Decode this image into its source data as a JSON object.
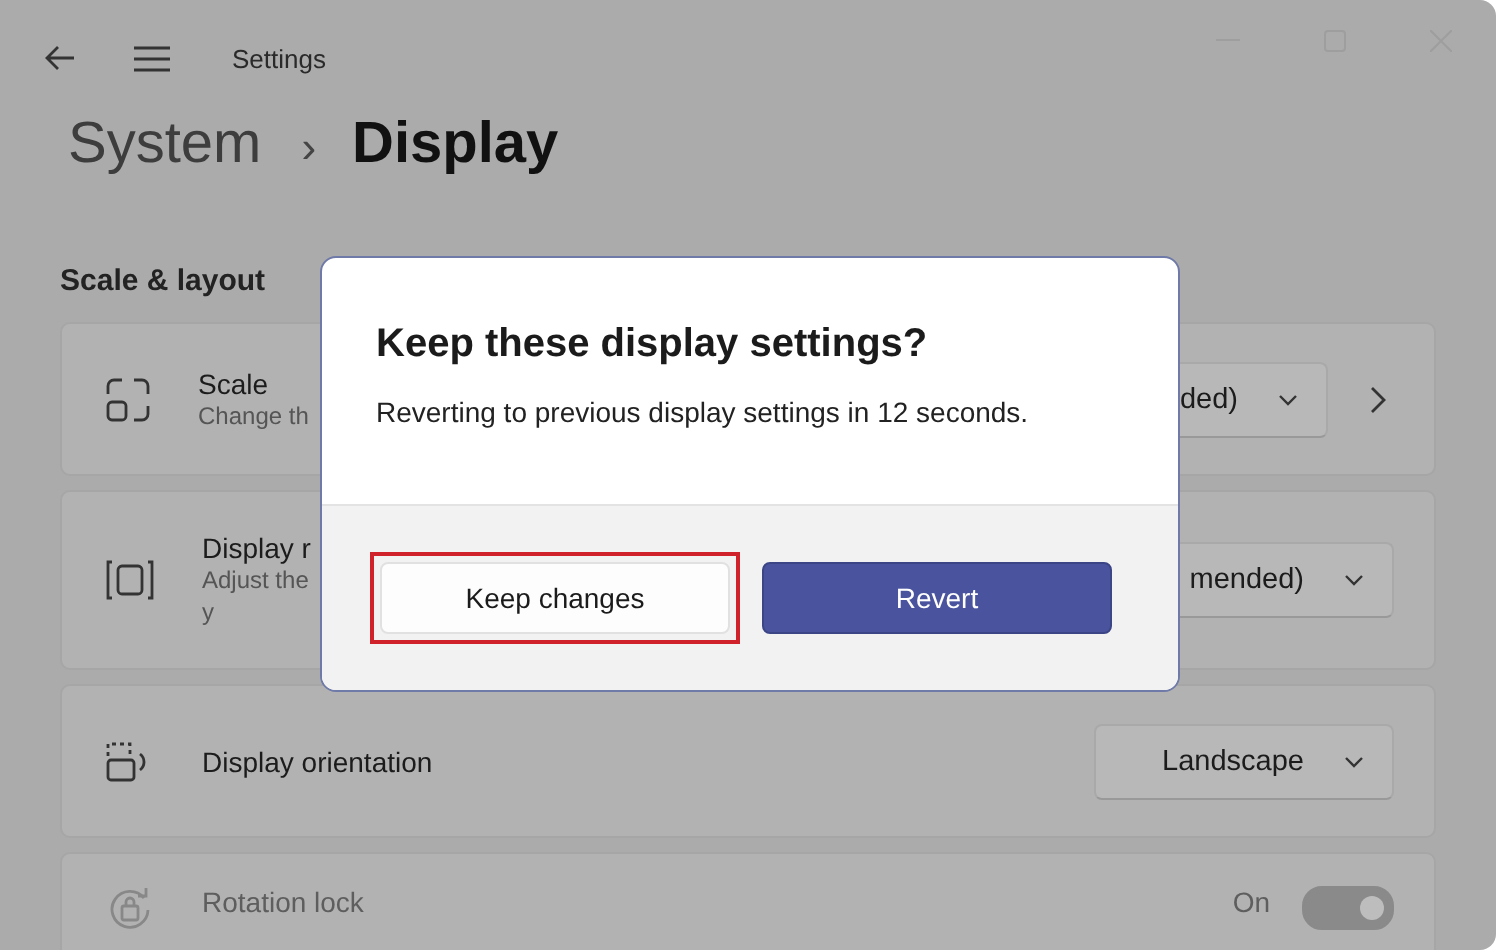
{
  "window": {
    "title": "Settings"
  },
  "breadcrumb": {
    "parent": "System",
    "separator": "›",
    "current": "Display"
  },
  "section": "Scale & layout",
  "rows": [
    {
      "kind": "dropdown",
      "title": "Scale",
      "subtitle": [
        "Change th"
      ],
      "value": "ded)",
      "link": true
    },
    {
      "kind": "dropdown",
      "title": "Display r",
      "subtitle": [
        "Adjust the",
        "y"
      ],
      "value": "mended)",
      "link": false
    },
    {
      "kind": "dropdown",
      "title": "Display orientation",
      "value": "Landscape",
      "link": false
    },
    {
      "kind": "toggle",
      "title": "Rotation lock",
      "disabled": true,
      "state": "On",
      "on": true
    }
  ],
  "dialog": {
    "title": "Keep these display settings?",
    "message": "Reverting to previous display settings in 12 seconds.",
    "buttons": [
      {
        "label": "Keep changes",
        "primary": false,
        "highlighted": true
      },
      {
        "label": "Revert",
        "primary": true,
        "highlighted": false
      }
    ]
  }
}
